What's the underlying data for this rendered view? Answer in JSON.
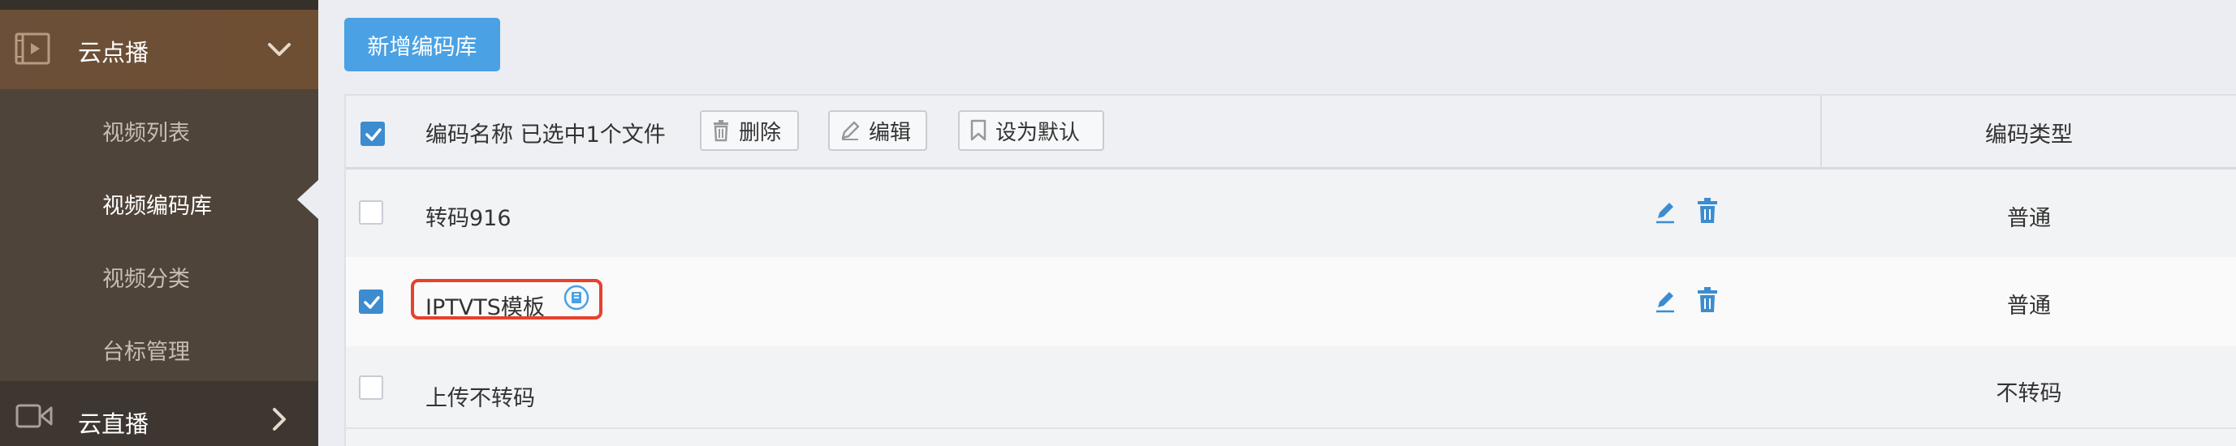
{
  "sidebar": {
    "vod_menu": {
      "label": "云点播",
      "icon": "video-player-icon",
      "expanded": true
    },
    "submenu": [
      {
        "label": "视频列表",
        "active": false
      },
      {
        "label": "视频编码库",
        "active": true
      },
      {
        "label": "视频分类",
        "active": false
      },
      {
        "label": "台标管理",
        "active": false
      }
    ],
    "live_menu": {
      "label": "云直播",
      "icon": "video-camera-icon",
      "expanded": false
    }
  },
  "toolbar": {
    "add_label": "新增编码库"
  },
  "table": {
    "header": {
      "name_col": "编码名称",
      "selection_text": "已选中1个文件",
      "delete_label": "删除",
      "edit_label": "编辑",
      "set_default_label": "设为默认",
      "type_col": "编码类型",
      "all_checked": true
    },
    "rows": [
      {
        "name": "转码916",
        "type": "普通",
        "checked": false,
        "is_default": false
      },
      {
        "name": "IPTVTS模板",
        "type": "普通",
        "checked": true,
        "is_default": true
      },
      {
        "name": "上传不转码",
        "type": "不转码",
        "checked": false,
        "is_default": false
      }
    ]
  },
  "colors": {
    "accent": "#4aa1e4",
    "checkbox": "#3c8ccf",
    "highlight": "#e8412c",
    "sidebar": "#4f4439"
  }
}
